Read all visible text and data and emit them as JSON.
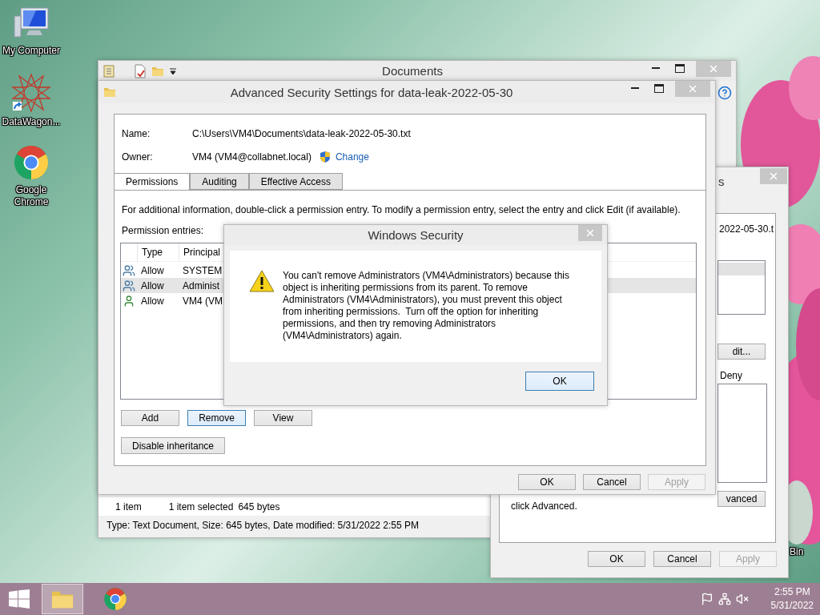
{
  "desktop": {
    "icons": [
      {
        "kind": "computer",
        "label": "My Computer"
      },
      {
        "kind": "app",
        "label": "DataWagon..."
      },
      {
        "kind": "browser",
        "label": "Google Chrome"
      }
    ],
    "bin_label": "Bin"
  },
  "explorer": {
    "title": "Documents",
    "item_count": "1 item",
    "selection": "1 item selected",
    "selection_size": "645 bytes",
    "details": "Type: Text Document, Size: 645 bytes, Date modified: 5/31/2022 2:55 PM"
  },
  "properties": {
    "title": "s",
    "object_name": "2022-05-30.t",
    "group_rows": [
      {
        "selected": true
      }
    ],
    "edit_button": "dit...",
    "deny_label": "Deny",
    "advanced_button": "vanced",
    "hint": "click Advanced.",
    "buttons": [
      {
        "label": "OK",
        "disabled": false
      },
      {
        "label": "Cancel",
        "disabled": false
      },
      {
        "label": "Apply",
        "disabled": true
      }
    ]
  },
  "advanced_security": {
    "title": "Advanced Security Settings for data-leak-2022-05-30",
    "name_label": "Name:",
    "name": "C:\\Users\\VM4\\Documents\\data-leak-2022-05-30.txt",
    "owner_label": "Owner:",
    "owner": "VM4 (VM4@collabnet.local)",
    "change_link": "Change",
    "tabs": [
      {
        "label": "Permissions",
        "selected": true
      },
      {
        "label": "Auditing",
        "selected": false
      },
      {
        "label": "Effective Access",
        "selected": false
      }
    ],
    "info": "For additional information, double-click a permission entry. To modify a permission entry, select the entry and click Edit (if available).",
    "entries_label": "Permission entries:",
    "columns": [
      "Type",
      "Principal"
    ],
    "entries": [
      {
        "kind": "group",
        "type": "Allow",
        "principal": "SYSTEM",
        "selected": false
      },
      {
        "kind": "group",
        "type": "Allow",
        "principal": "Administ",
        "selected": true
      },
      {
        "kind": "user",
        "type": "Allow",
        "principal": "VM4 (VM",
        "selected": false
      }
    ],
    "actions": [
      {
        "label": "Add",
        "focused": false
      },
      {
        "label": "Remove",
        "focused": true
      },
      {
        "label": "View",
        "focused": false
      }
    ],
    "inheritance_button": "Disable inheritance",
    "buttons": [
      {
        "label": "OK",
        "disabled": false
      },
      {
        "label": "Cancel",
        "disabled": false
      },
      {
        "label": "Apply",
        "disabled": true
      }
    ]
  },
  "security_alert": {
    "title": "Windows Security",
    "message": "You can't remove Administrators (VM4\\Administrators) because this object is inheriting permissions from its parent. To remove Administrators (VM4\\Administrators), you must prevent this object from inheriting permissions.  Turn off the option for inheriting permissions, and then try removing Administrators (VM4\\Administrators) again.",
    "button": {
      "label": "OK",
      "focused": true
    }
  },
  "taskbar": {
    "apps": [
      {
        "kind": "explorer",
        "active": true
      },
      {
        "kind": "browser",
        "active": false
      }
    ],
    "time": "2:55 PM",
    "date": "5/31/2022"
  }
}
